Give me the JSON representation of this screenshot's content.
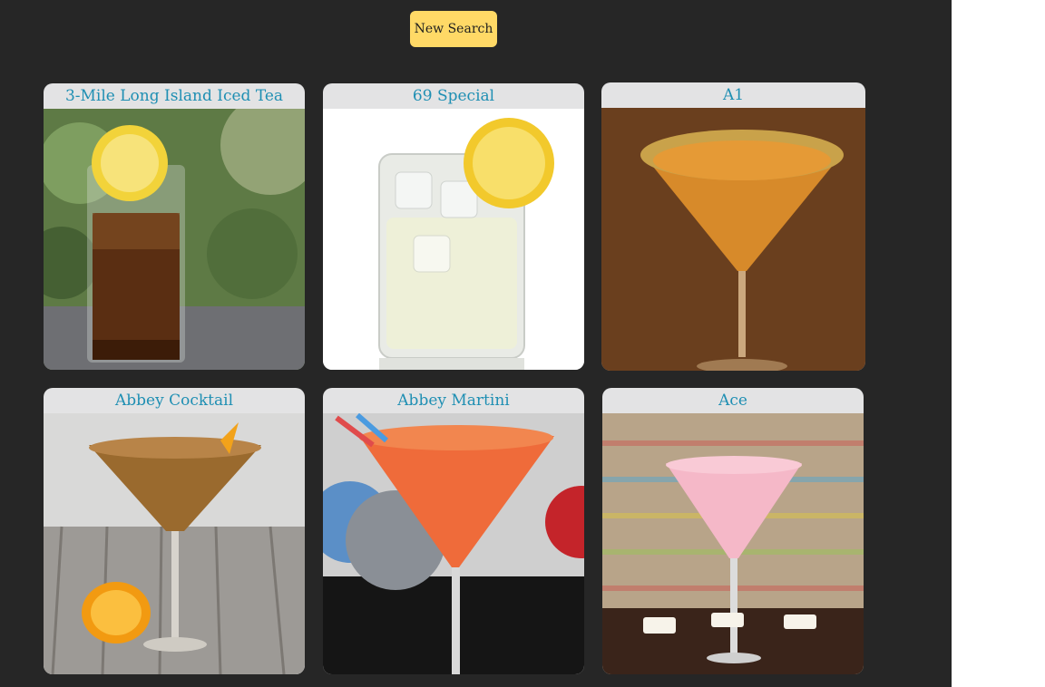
{
  "toolbar": {
    "new_search_label": "New Search"
  },
  "colors": {
    "background": "#262626",
    "button": "#ffd966",
    "card_header": "#e3e3e4",
    "card_title": "#1f8fb3"
  },
  "cocktails": [
    {
      "name": "3-Mile Long Island Iced Tea"
    },
    {
      "name": "69 Special"
    },
    {
      "name": "A1"
    },
    {
      "name": "Abbey Cocktail"
    },
    {
      "name": "Abbey Martini"
    },
    {
      "name": "Ace"
    }
  ]
}
